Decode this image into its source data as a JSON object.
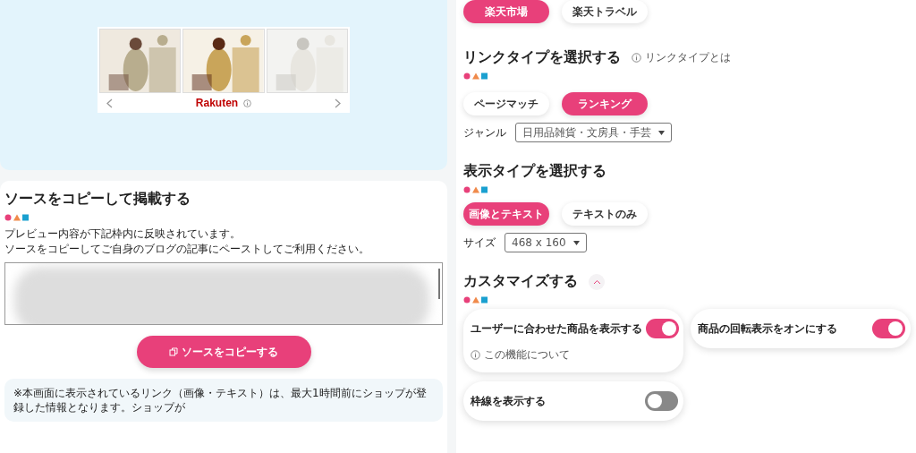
{
  "preview": {
    "ad": {
      "logo": "Rakuten"
    }
  },
  "source_section": {
    "title": "ソースをコピーして掲載する",
    "description": [
      "プレビュー内容が下記枠内に反映されています。",
      "ソースをコピーしてご自身のブログの記事にペーストしてご利用ください。"
    ],
    "copy_button": "ソースをコピーする",
    "note": "※本画面に表示されているリンク（画像・テキスト）は、最大1時間前にショップが登録した情報となります。ショップが"
  },
  "service_tabs": [
    {
      "label": "楽天市場",
      "selected": true
    },
    {
      "label": "楽天トラベル",
      "selected": false
    }
  ],
  "link_type": {
    "title": "リンクタイプを選択する",
    "help_link": "リンクタイプとは",
    "options": [
      {
        "label": "ページマッチ",
        "selected": false
      },
      {
        "label": "ランキング",
        "selected": true
      }
    ],
    "genre": {
      "label": "ジャンル",
      "value": "日用品雑貨・文房具・手芸"
    }
  },
  "display_type": {
    "title": "表示タイプを選択する",
    "options": [
      {
        "label": "画像とテキスト",
        "selected": true
      },
      {
        "label": "テキストのみ",
        "selected": false
      }
    ],
    "size": {
      "label": "サイズ",
      "value": "468 x 160"
    }
  },
  "customize": {
    "title": "カスタマイズする",
    "expanded": true,
    "toggles": [
      {
        "label": "ユーザーに合わせた商品を表示する",
        "on": true,
        "help": "この機能について"
      },
      {
        "label": "商品の回転表示をオンにする",
        "on": true
      },
      {
        "label": "枠線を表示する",
        "on": false
      }
    ]
  }
}
